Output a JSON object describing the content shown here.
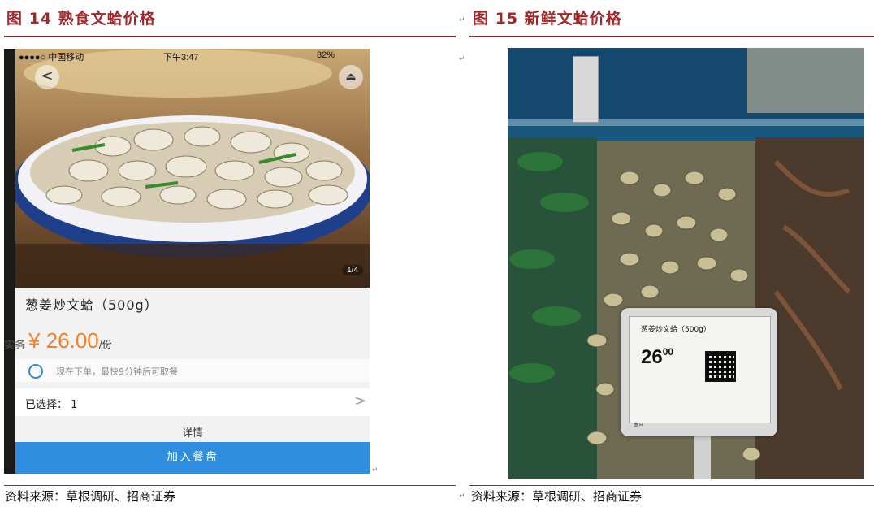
{
  "figures": [
    {
      "title": "图 14  熟食文蛤价格",
      "source": "资料来源：草根调研、招商证券",
      "phone": {
        "status_carrier": "●●●●○ 中国移动",
        "status_time": "下午3:47",
        "status_battery": "82%",
        "back_glyph": "<",
        "share_glyph": "⏏",
        "page_indicator": "1/4",
        "dish_title": "葱姜炒文蛤（500g）",
        "price": "¥ 26.00",
        "price_unit": "/份",
        "pickup_note": "现在下单，最快9分钟后可取餐",
        "selected_label": "已选择：  1",
        "detail_tab": "详情",
        "add_button": "加入餐盘",
        "cut_text": "实务"
      }
    },
    {
      "title": "图 15  新鲜文蛤价格",
      "source": "资料来源：草根调研、招商证券",
      "price_tag": {
        "name": "葱姜炒文蛤（500g）",
        "price": "26",
        "cents": "00",
        "footer": "盒马"
      }
    }
  ],
  "return_mark": "↵",
  "colors": {
    "title": "#a0282b",
    "rule": "#8b2a2a",
    "button": "#2f8ee0",
    "price": "#f0812a"
  }
}
